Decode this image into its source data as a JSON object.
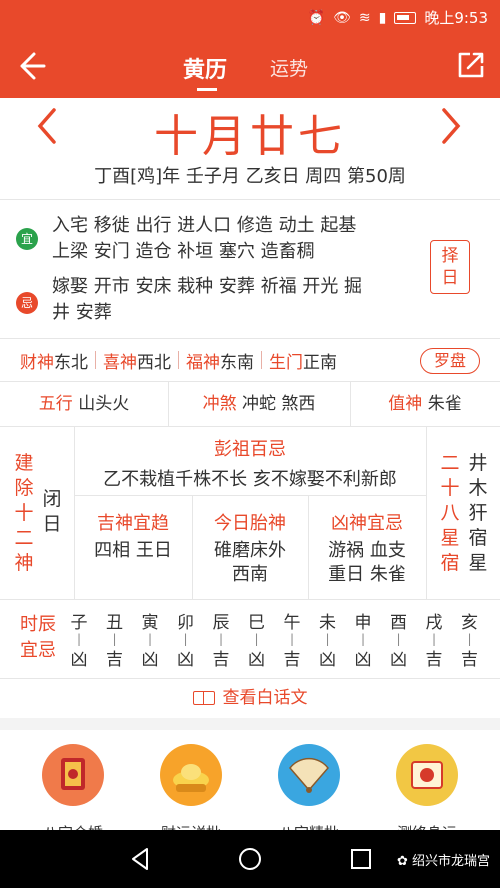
{
  "status_bar": {
    "time": "晚上9:53"
  },
  "header": {
    "tabs": [
      "黄历",
      "运势"
    ]
  },
  "date": {
    "lunar": "十月廿七",
    "ganzhi": "丁酉[鸡]年 壬子月 乙亥日 周四 第50周"
  },
  "yi": {
    "badge": "宜",
    "lines": [
      "入宅 移徙 出行 进人口 修造 动土 起基",
      "上梁 安门 造仓 补垣 塞穴 造畜稠"
    ]
  },
  "ji": {
    "badge": "忌",
    "lines": [
      "嫁娶 开市 安床 栽种 安葬 祈福 开光 掘",
      "井 安葬"
    ]
  },
  "zeri_button": [
    "择",
    "日"
  ],
  "gods": [
    {
      "k": "财神",
      "v": "东北"
    },
    {
      "k": "喜神",
      "v": "西北"
    },
    {
      "k": "福神",
      "v": "东南"
    },
    {
      "k": "生门",
      "v": "正南"
    }
  ],
  "luopan": "罗盘",
  "wuxing": {
    "k": "五行",
    "v": "山头火"
  },
  "chongsha": {
    "k": "冲煞",
    "v": "冲蛇 煞西"
  },
  "zhishen": {
    "k": "值神",
    "v": "朱雀"
  },
  "jianchu": {
    "label": [
      "建",
      "除",
      "十",
      "二",
      "神"
    ],
    "value": [
      "闭",
      "日"
    ]
  },
  "xingsu": {
    "label": [
      "二",
      "十",
      "八",
      "星",
      "宿"
    ],
    "value": [
      "井",
      "木",
      "犴",
      "宿",
      "星"
    ]
  },
  "pengzu": {
    "title": "彭祖百忌",
    "text": "乙不栽植千株不长 亥不嫁娶不利新郎"
  },
  "jishen": {
    "title": "吉神宜趋",
    "text": "四相 王日"
  },
  "taishen": {
    "title": "今日胎神",
    "line1": "碓磨床外",
    "line2": "西南"
  },
  "xiongshen": {
    "title": "凶神宜忌",
    "line1": "游祸 血支",
    "line2": "重日 朱雀"
  },
  "hours_label": [
    "时辰",
    "宜忌"
  ],
  "hours": [
    {
      "b": "子",
      "l": "凶"
    },
    {
      "b": "丑",
      "l": "吉"
    },
    {
      "b": "寅",
      "l": "凶"
    },
    {
      "b": "卯",
      "l": "凶"
    },
    {
      "b": "辰",
      "l": "吉"
    },
    {
      "b": "巳",
      "l": "凶"
    },
    {
      "b": "午",
      "l": "吉"
    },
    {
      "b": "未",
      "l": "凶"
    },
    {
      "b": "申",
      "l": "凶"
    },
    {
      "b": "酉",
      "l": "凶"
    },
    {
      "b": "戌",
      "l": "吉"
    },
    {
      "b": "亥",
      "l": "吉"
    }
  ],
  "view_text": "查看白话文",
  "features": [
    "八字合婚",
    "财运详批",
    "八字精批",
    "测终身运"
  ],
  "watermark": "绍兴市龙瑞宫"
}
